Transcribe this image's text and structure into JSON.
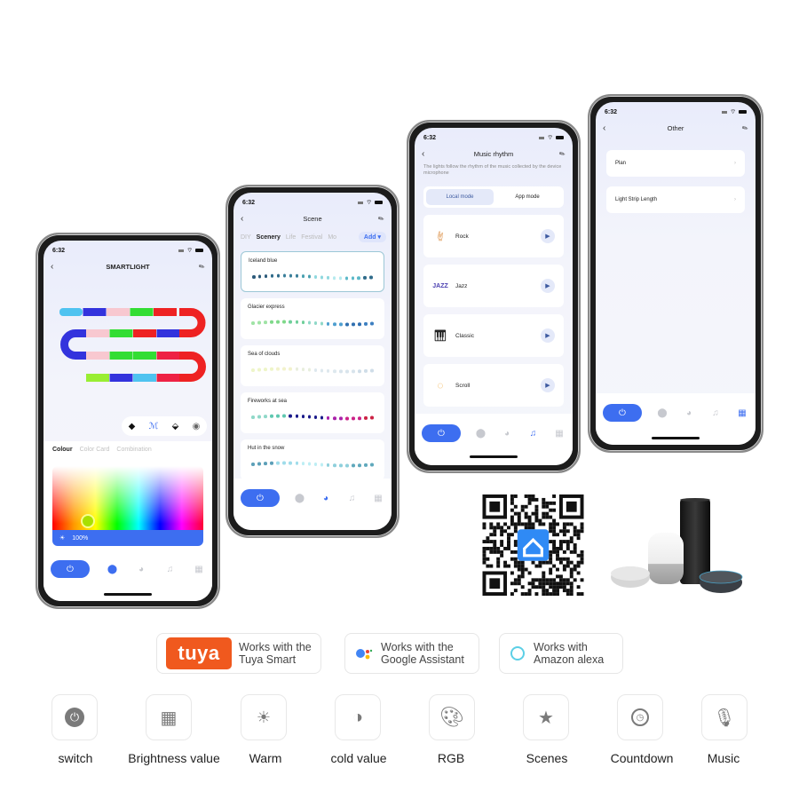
{
  "status_time": "6:32",
  "phone1": {
    "title": "SMARTLIGHT",
    "strip_tools": [
      "fill-icon",
      "brush-icon",
      "eraser-icon",
      "color-picker-icon"
    ],
    "tabs": [
      "Colour",
      "Color Card",
      "Combination"
    ],
    "active_tab": "Colour",
    "brightness_label": "100%",
    "brightness_percent": 100,
    "strip_rows": [
      [
        "#4fc3f0",
        "#3333dd",
        "#f8c8d0",
        "#33dd33",
        "#ee2222",
        "#ee2222"
      ],
      [
        "#f8c8d0",
        "#33dd33",
        "#ee2222",
        "#3333dd"
      ],
      [
        "#f8c8d0",
        "#33dd33",
        "#33dd33",
        "#ee2244",
        "#ee2222"
      ],
      [
        "#99ee33",
        "#3333dd",
        "#4fc3f0",
        "#ee2244"
      ]
    ],
    "active_nav": "color"
  },
  "phone2": {
    "title": "Scene",
    "tabs": [
      "DIY",
      "Scenery",
      "Life",
      "Festival",
      "Mo"
    ],
    "active_tab": "Scenery",
    "add_label": "Add",
    "scenes": [
      {
        "name": "Iceland blue",
        "colors": [
          "#2c5a7a",
          "#2f6b8a",
          "#3b7f9a",
          "#4aa0b0",
          "#8fd8de",
          "#b5eaee",
          "#5cb8c8",
          "#2f6b8a"
        ],
        "selected": true
      },
      {
        "name": "Glacier express",
        "colors": [
          "#9fe3a5",
          "#7fd98a",
          "#6fcf9a",
          "#8fd8c8",
          "#4f9fd0",
          "#2f6fb0",
          "#3c7fc0"
        ]
      },
      {
        "name": "Sea of clouds",
        "colors": [
          "#eef5c8",
          "#f2f2cc",
          "#e8eedd",
          "#dde8ee",
          "#d8e4ec",
          "#cfdde8"
        ]
      },
      {
        "name": "Fireworks at sea",
        "colors": [
          "#8fd8c8",
          "#5fc8b0",
          "#1a1a8a",
          "#1a1a8a",
          "#aa22aa",
          "#cc2288",
          "#cc2244"
        ]
      },
      {
        "name": "Hut in the snow",
        "colors": [
          "#5c9fb8",
          "#9fdcea",
          "#bdeef4",
          "#8fd0dc",
          "#5fa8bc"
        ]
      }
    ],
    "active_nav": "scene"
  },
  "phone3": {
    "title": "Music rhythm",
    "description": "The lights follow the rhythm of the music collected by the device microphone",
    "modes": [
      "Local mode",
      "App mode"
    ],
    "active_mode": "Local mode",
    "items": [
      {
        "name": "Rock",
        "icon": "rock-hand-icon"
      },
      {
        "name": "Jazz",
        "icon": "jazz-icon"
      },
      {
        "name": "Classic",
        "icon": "piano-icon"
      },
      {
        "name": "Scroll",
        "icon": "scroll-icon"
      }
    ],
    "active_nav": "music"
  },
  "phone4": {
    "title": "Other",
    "items": [
      "Plan",
      "Light Strip Length"
    ],
    "active_nav": "other"
  },
  "badges": [
    {
      "logo": "tuya",
      "line1": "Works  with the",
      "line2": "Tuya Smart"
    },
    {
      "logo": "google-assistant",
      "line1": "Works  with the",
      "line2": "Google Assistant"
    },
    {
      "logo": "alexa",
      "line1": "Works with",
      "line2": "Amazon alexa"
    }
  ],
  "tuya_logo_text": "tuya",
  "features": [
    {
      "label": "switch",
      "icon": "power-icon"
    },
    {
      "label": "Brightness value",
      "icon": "grid-icon"
    },
    {
      "label": "Warm",
      "icon": "sun-icon"
    },
    {
      "label": "cold value",
      "icon": "half-circle-icon"
    },
    {
      "label": "RGB",
      "icon": "palette-icon"
    },
    {
      "label": "Scenes",
      "icon": "star-icon"
    },
    {
      "label": "Countdown",
      "icon": "clock-icon"
    },
    {
      "label": "Music",
      "icon": "microphone-icon"
    }
  ],
  "colors": {
    "accent": "#3d6ef0",
    "tuya": "#f0591e"
  }
}
